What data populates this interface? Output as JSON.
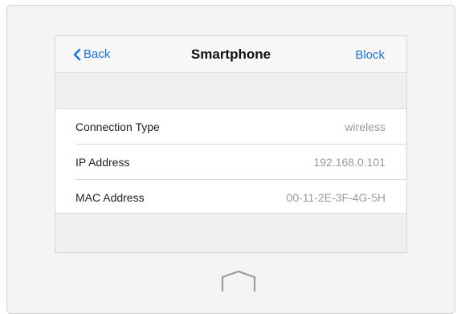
{
  "navbar": {
    "back_label": "Back",
    "title": "Smartphone",
    "block_label": "Block"
  },
  "info": [
    {
      "label": "Connection Type",
      "value": "wireless"
    },
    {
      "label": "IP Address",
      "value": "192.168.0.101"
    },
    {
      "label": "MAC Address",
      "value": "00-11-2E-3F-4G-5H"
    }
  ],
  "icons": {
    "back": "chevron-left-icon",
    "home": "home-button-icon"
  },
  "colors": {
    "accent": "#1a73e0",
    "value_text": "#9a9a9a"
  }
}
